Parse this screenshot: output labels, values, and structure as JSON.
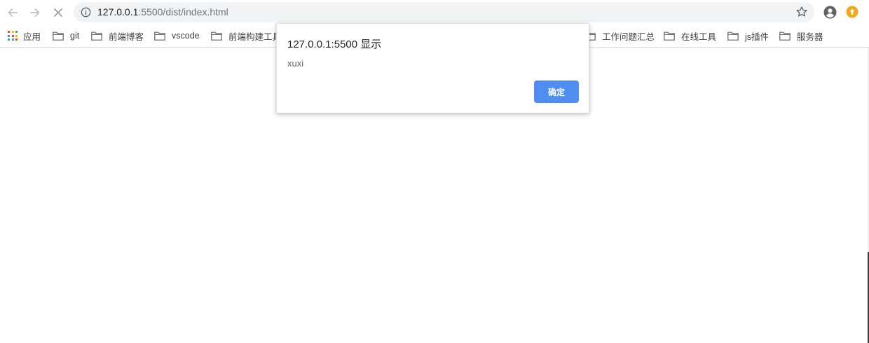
{
  "toolbar": {
    "back_icon": "arrow-left-icon",
    "forward_icon": "arrow-right-icon",
    "stop_icon": "close-icon",
    "site_info_icon": "info-icon",
    "url_host": "127.0.0.1",
    "url_rest": ":5500/dist/index.html",
    "bookmark_star_icon": "star-icon",
    "profile_icon": "account-circle-icon",
    "extension_icon": "extension-icon"
  },
  "bookmarks": {
    "apps_label": "应用",
    "items": [
      {
        "label": "git",
        "icon": "folder-icon"
      },
      {
        "label": "前端博客",
        "icon": "folder-icon"
      },
      {
        "label": "vscode",
        "icon": "folder-icon"
      },
      {
        "label": "前端构建工具",
        "icon": "folder-icon"
      },
      {
        "label": "工作问题汇总",
        "icon": "folder-icon"
      },
      {
        "label": "在线工具",
        "icon": "folder-icon"
      },
      {
        "label": "js插件",
        "icon": "folder-icon"
      },
      {
        "label": "服务器",
        "icon": "folder-icon"
      }
    ]
  },
  "dialog": {
    "title": "127.0.0.1:5500 显示",
    "message": "xuxi",
    "ok_label": "确定"
  },
  "colors": {
    "accent": "#4f8ef0",
    "extension": "#f0a81d",
    "omnibox_bg": "#f1f3f4"
  }
}
